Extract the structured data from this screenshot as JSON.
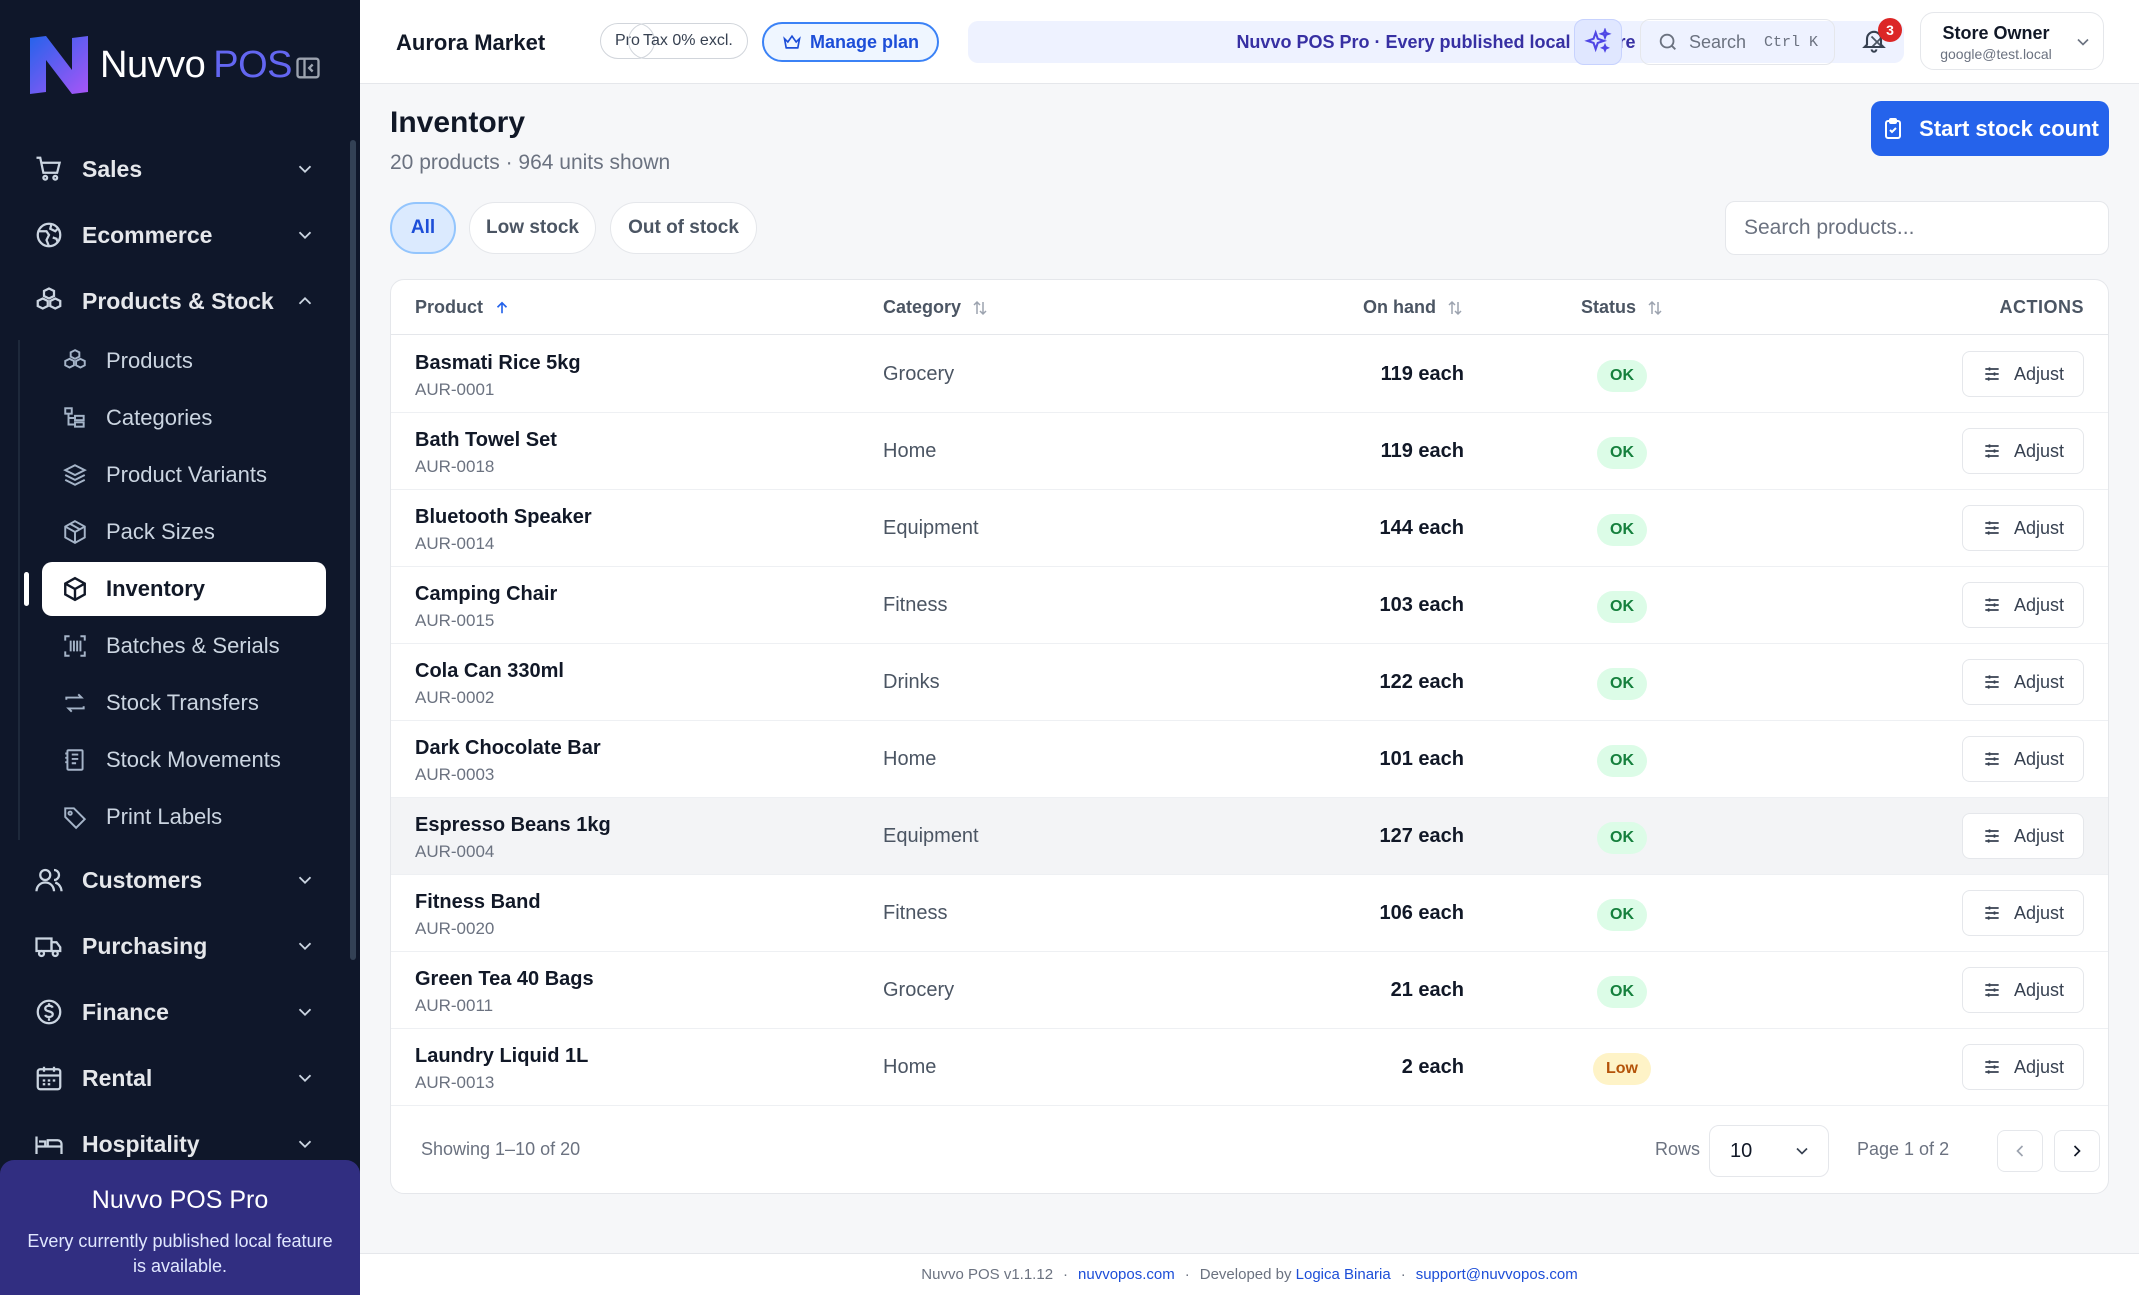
{
  "app": {
    "brand_word1": "Nuvvo",
    "brand_word2": "POS",
    "accent": "#2563eb",
    "sidebar_bg": "#0f172a"
  },
  "sidebar": {
    "groups": [
      {
        "label": "Sales",
        "icon": "cart-icon",
        "expanded": false
      },
      {
        "label": "Ecommerce",
        "icon": "globe-icon",
        "expanded": false
      },
      {
        "label": "Products & Stock",
        "icon": "boxes-icon",
        "expanded": true
      },
      {
        "label": "Customers",
        "icon": "users-icon",
        "expanded": false
      },
      {
        "label": "Purchasing",
        "icon": "truck-icon",
        "expanded": false
      },
      {
        "label": "Finance",
        "icon": "dollar-icon",
        "expanded": false
      },
      {
        "label": "Rental",
        "icon": "calendar-icon",
        "expanded": false
      },
      {
        "label": "Hospitality",
        "icon": "bed-icon",
        "expanded": false
      }
    ],
    "sub_items": [
      {
        "label": "Products",
        "icon": "boxes-icon"
      },
      {
        "label": "Categories",
        "icon": "tree-icon"
      },
      {
        "label": "Product Variants",
        "icon": "layers-icon"
      },
      {
        "label": "Pack Sizes",
        "icon": "package-icon"
      },
      {
        "label": "Inventory",
        "icon": "cube-icon",
        "active": true
      },
      {
        "label": "Batches & Serials",
        "icon": "scan-icon"
      },
      {
        "label": "Stock Transfers",
        "icon": "transfer-icon"
      },
      {
        "label": "Stock Movements",
        "icon": "ledger-icon"
      },
      {
        "label": "Print Labels",
        "icon": "tag-icon"
      }
    ],
    "promo": {
      "title": "Nuvvo POS Pro",
      "desc": "Every currently published local feature is available."
    }
  },
  "topbar": {
    "store_name": "Aurora Market",
    "plan_badge": "Pro",
    "tax_badge": "Tax 0% excl.",
    "manage_plan": "Manage plan",
    "banner": "Nuvvo POS Pro · Every published local feature",
    "search_label": "Search",
    "search_shortcut": "Ctrl K",
    "notifications_count": "3",
    "user_name": "Store Owner",
    "user_email": "google@test.local"
  },
  "page": {
    "title": "Inventory",
    "subtitle": "20 products · 964 units shown",
    "primary_action": "Start stock count",
    "filters": [
      "All",
      "Low stock",
      "Out of stock"
    ],
    "active_filter": "All",
    "search_placeholder": "Search products..."
  },
  "table": {
    "columns": {
      "product": "Product",
      "category": "Category",
      "on_hand": "On hand",
      "status": "Status",
      "actions": "ACTIONS"
    },
    "action_label": "Adjust",
    "rows": [
      {
        "name": "Basmati Rice 5kg",
        "sku": "AUR-0001",
        "category": "Grocery",
        "on_hand": "119 each",
        "status": "OK"
      },
      {
        "name": "Bath Towel Set",
        "sku": "AUR-0018",
        "category": "Home",
        "on_hand": "119 each",
        "status": "OK"
      },
      {
        "name": "Bluetooth Speaker",
        "sku": "AUR-0014",
        "category": "Equipment",
        "on_hand": "144 each",
        "status": "OK"
      },
      {
        "name": "Camping Chair",
        "sku": "AUR-0015",
        "category": "Fitness",
        "on_hand": "103 each",
        "status": "OK"
      },
      {
        "name": "Cola Can 330ml",
        "sku": "AUR-0002",
        "category": "Drinks",
        "on_hand": "122 each",
        "status": "OK"
      },
      {
        "name": "Dark Chocolate Bar",
        "sku": "AUR-0003",
        "category": "Home",
        "on_hand": "101 each",
        "status": "OK"
      },
      {
        "name": "Espresso Beans 1kg",
        "sku": "AUR-0004",
        "category": "Equipment",
        "on_hand": "127 each",
        "status": "OK"
      },
      {
        "name": "Fitness Band",
        "sku": "AUR-0020",
        "category": "Fitness",
        "on_hand": "106 each",
        "status": "OK"
      },
      {
        "name": "Green Tea 40 Bags",
        "sku": "AUR-0011",
        "category": "Grocery",
        "on_hand": "21 each",
        "status": "OK"
      },
      {
        "name": "Laundry Liquid 1L",
        "sku": "AUR-0013",
        "category": "Home",
        "on_hand": "2 each",
        "status": "Low"
      }
    ],
    "showing": "Showing 1–10 of 20",
    "rows_label": "Rows",
    "rows_value": "10",
    "page_label": "Page 1 of 2"
  },
  "footer": {
    "version": "Nuvvo POS v1.1.12",
    "site": "nuvvopos.com",
    "developed_by": "Developed by",
    "company": "Logica Binaria",
    "support": "support@nuvvopos.com"
  }
}
